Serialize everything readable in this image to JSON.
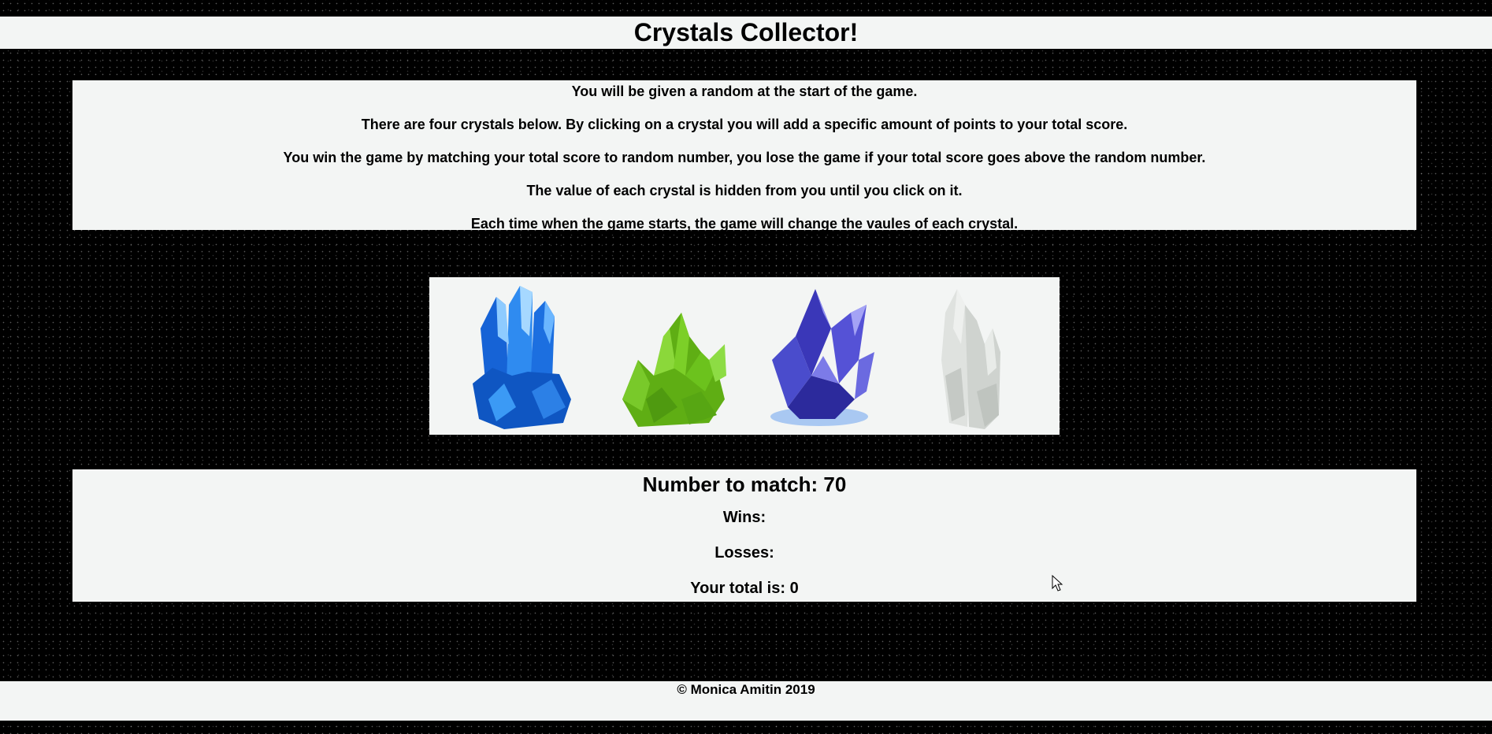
{
  "header": {
    "title": "Crystals Collector!"
  },
  "instructions": [
    "You will be given a random at the start of the game.",
    "There are four crystals below. By clicking on a crystal you will add a specific amount of points to your total score.",
    "You win the game by matching your total score to random number, you lose the game if your total score goes above the random number.",
    "The value of each crystal is hidden from you until you click on it.",
    "Each time when the game starts, the game will change the vaules of each crystal."
  ],
  "crystals": [
    {
      "name": "blue-crystal",
      "color": "#1e73e8"
    },
    {
      "name": "green-crystal",
      "color": "#6fbf1a"
    },
    {
      "name": "purple-crystal",
      "color": "#4a48c9"
    },
    {
      "name": "clear-crystal",
      "color": "#d9dcd9"
    }
  ],
  "scoreboard": {
    "target_label": "Number to match: 70",
    "wins_label": "Wins:",
    "losses_label": "Losses:",
    "total_label": "Your total is: 0"
  },
  "footer": {
    "text": "© Monica Amitin 2019"
  }
}
